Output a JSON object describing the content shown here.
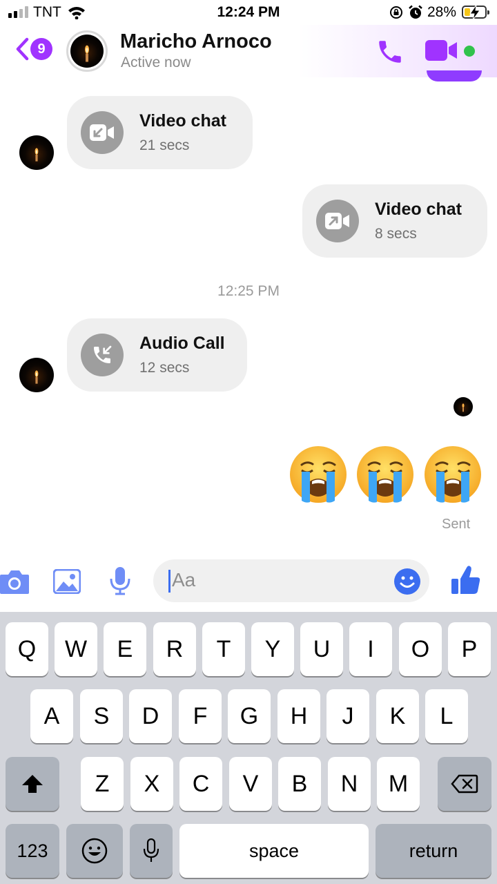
{
  "status_bar": {
    "carrier": "TNT",
    "time": "12:24 PM",
    "battery_percent": "28%",
    "battery_level": 0.28,
    "signal_bars": 2,
    "icons": [
      "signal-icon",
      "wifi-icon",
      "orientation-lock-icon",
      "alarm-icon",
      "battery-charging-icon"
    ]
  },
  "header": {
    "back_badge": "9",
    "contact_name": "Maricho Arnoco",
    "contact_status": "Active now",
    "accent_color": "#a033ff",
    "online_color": "#31c24c"
  },
  "messages": [
    {
      "side": "received",
      "type": "video",
      "direction": "incoming",
      "title": "Video chat",
      "duration": "21 secs"
    },
    {
      "side": "sent",
      "type": "video",
      "direction": "outgoing",
      "title": "Video chat",
      "duration": "8 secs"
    },
    {
      "side": "received",
      "type": "audio",
      "direction": "incoming",
      "title": "Audio Call",
      "duration": "12 secs"
    }
  ],
  "timestamp": "12:25 PM",
  "emojis": [
    "😭",
    "😭",
    "😭"
  ],
  "sent_status": "Sent",
  "composer": {
    "placeholder": "Aa",
    "icons": [
      "camera-icon",
      "photo-icon",
      "microphone-icon",
      "emoji-icon",
      "thumbs-up-icon"
    ]
  },
  "keyboard": {
    "row1": [
      "Q",
      "W",
      "E",
      "R",
      "T",
      "Y",
      "U",
      "I",
      "O",
      "P"
    ],
    "row2": [
      "A",
      "S",
      "D",
      "F",
      "G",
      "H",
      "J",
      "K",
      "L"
    ],
    "row3": [
      "Z",
      "X",
      "C",
      "V",
      "B",
      "N",
      "M"
    ],
    "numbers_label": "123",
    "space_label": "space",
    "return_label": "return"
  }
}
